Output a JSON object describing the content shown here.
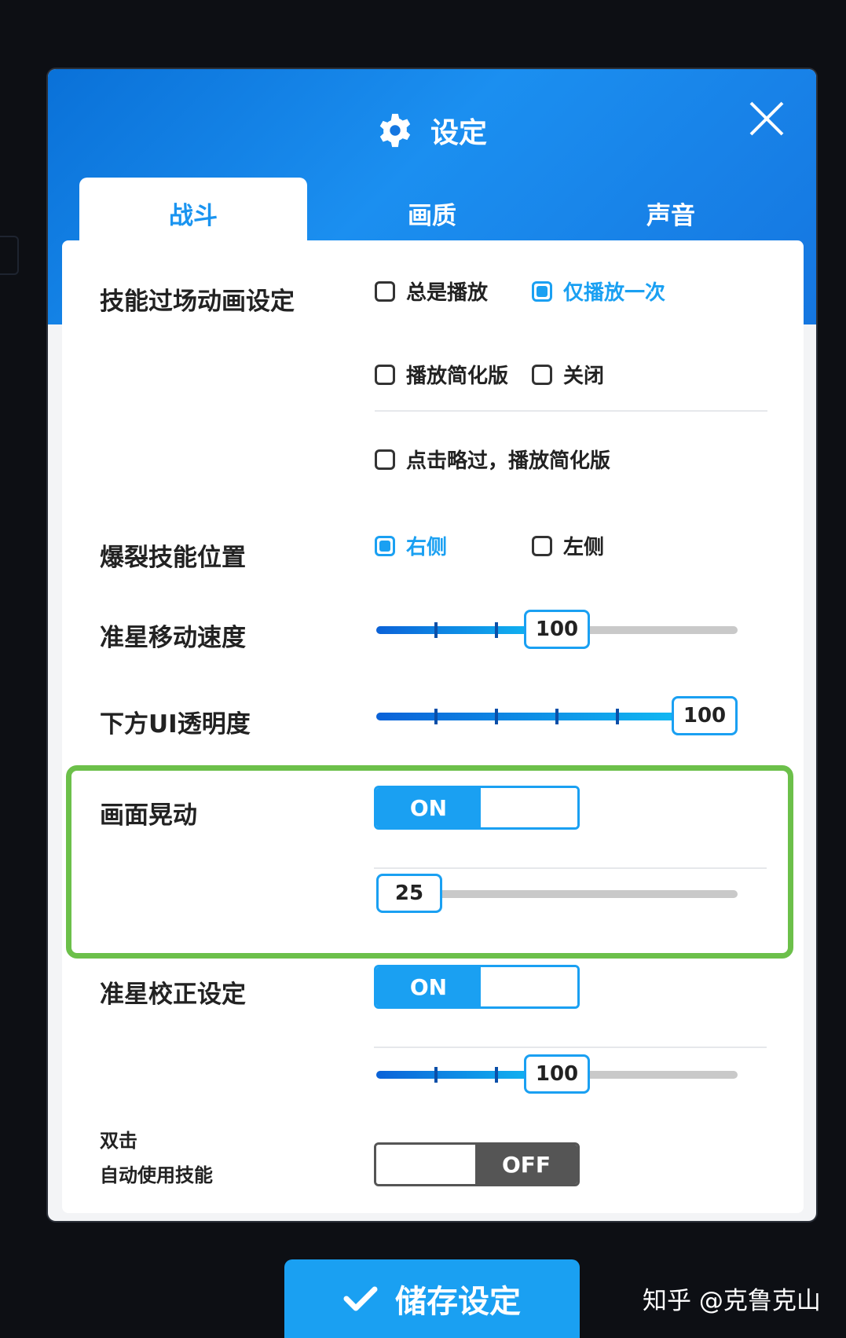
{
  "dialog": {
    "title": "设定",
    "tabs": [
      {
        "label": "战斗",
        "active": true
      },
      {
        "label": "画质",
        "active": false
      },
      {
        "label": "声音",
        "active": false
      }
    ]
  },
  "skill_cutscene": {
    "label": "技能过场动画设定",
    "options": [
      {
        "label": "总是播放",
        "checked": false
      },
      {
        "label": "仅播放一次",
        "checked": true
      },
      {
        "label": "播放简化版",
        "checked": false
      },
      {
        "label": "关闭",
        "checked": false
      },
      {
        "label": "点击略过，播放简化版",
        "checked": false
      }
    ]
  },
  "burst_position": {
    "label": "爆裂技能位置",
    "options": [
      {
        "label": "右侧",
        "checked": true
      },
      {
        "label": "左侧",
        "checked": false
      }
    ]
  },
  "crosshair_speed": {
    "label": "准星移动速度",
    "value": "100",
    "fraction": 0.5
  },
  "bottom_ui_opacity": {
    "label": "下方UI透明度",
    "value": "100",
    "fraction": 1.0
  },
  "screen_shake": {
    "label": "画面晃动",
    "toggle": "ON",
    "value": "25",
    "fraction": 0.0
  },
  "aim_correction": {
    "label": "准星校正设定",
    "toggle": "ON",
    "value": "100",
    "fraction": 0.5
  },
  "double_tap": {
    "label_line1": "双击",
    "label_line2": "自动使用技能",
    "toggle": "OFF"
  },
  "save_button": {
    "label": "储存设定"
  },
  "watermark": "知乎 @克鲁克山",
  "colors": {
    "accent": "#1aa0f2",
    "header": "#1576e0",
    "highlight": "#6cc04a",
    "off": "#555555"
  }
}
